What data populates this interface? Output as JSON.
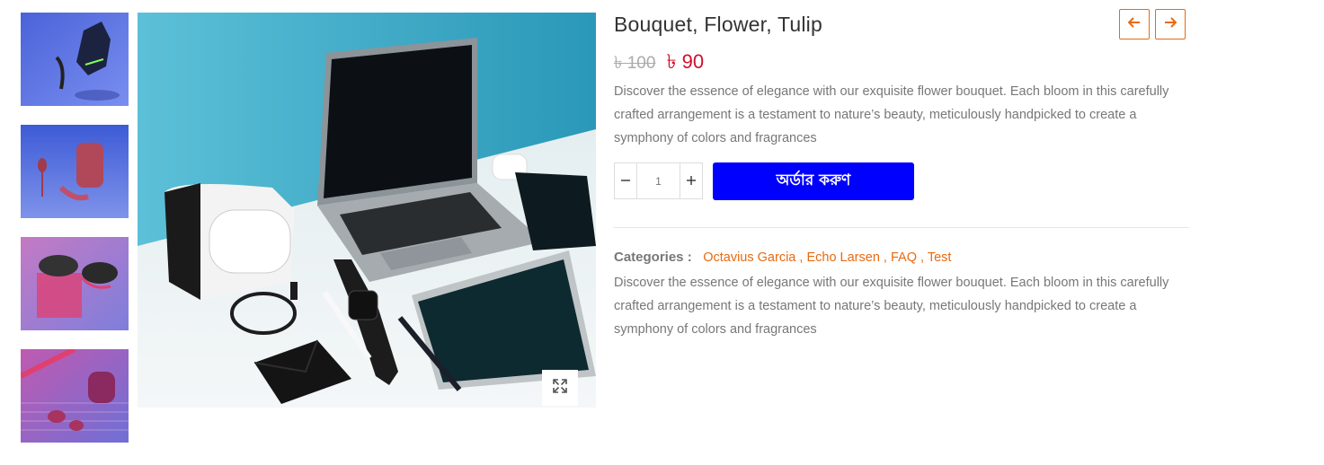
{
  "product": {
    "title": "Bouquet, Flower, Tulip",
    "old_price": "৳ 100",
    "new_price": "৳ 90",
    "description": "Discover the essence of elegance with our exquisite flower bouquet. Each bloom in this carefully crafted arrangement is a testament to nature’s beauty, meticulously handpicked to create a symphony of colors and fragrances",
    "quantity": "1",
    "order_label": "অর্ডার করুণ",
    "categories_label": "Categories :",
    "categories": [
      "Octavius Garcia",
      "Echo Larsen",
      "FAQ",
      "Test"
    ],
    "category_separator": " , "
  },
  "icons": {
    "prev": "arrow-left-icon",
    "next": "arrow-right-icon",
    "zoom": "expand-icon",
    "minus": "minus-icon",
    "plus": "plus-icon"
  },
  "colors": {
    "accent": "#e86a10",
    "price": "#d0102e",
    "order_button": "#0000ff"
  }
}
